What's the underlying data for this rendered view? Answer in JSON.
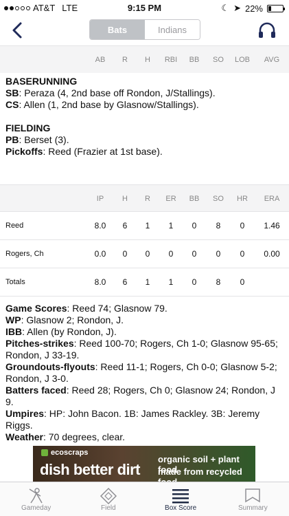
{
  "status": {
    "carrier": "AT&T",
    "network": "LTE",
    "time": "9:15 PM",
    "battery": "22%",
    "battery_level": 0.22
  },
  "nav": {
    "tabs": [
      "Bats",
      "Indians"
    ],
    "active_tab": "Bats"
  },
  "batting_header": [
    "AB",
    "R",
    "H",
    "RBI",
    "BB",
    "SO",
    "LOB",
    "AVG"
  ],
  "baserunning": {
    "title": "BASERUNNING",
    "lines": [
      {
        "label": "SB",
        "text": ": Peraza (4, 2nd base off Rondon, J/Stallings)."
      },
      {
        "label": "CS",
        "text": ": Allen (1, 2nd base by Glasnow/Stallings)."
      }
    ]
  },
  "fielding": {
    "title": "FIELDING",
    "lines": [
      {
        "label": "PB",
        "text": ": Berset (3)."
      },
      {
        "label": "Pickoffs",
        "text": ": Reed (Frazier at 1st base)."
      }
    ]
  },
  "pitching_header": [
    "IP",
    "H",
    "R",
    "ER",
    "BB",
    "SO",
    "HR",
    "ERA"
  ],
  "pitching_rows": [
    {
      "name": "Reed",
      "stats": [
        "8.0",
        "6",
        "1",
        "1",
        "0",
        "8",
        "0",
        "1.46"
      ]
    },
    {
      "name": "Rogers, Ch",
      "stats": [
        "0.0",
        "0",
        "0",
        "0",
        "0",
        "0",
        "0",
        "0.00"
      ]
    },
    {
      "name": "Totals",
      "stats": [
        "8.0",
        "6",
        "1",
        "1",
        "0",
        "8",
        "0",
        ""
      ]
    }
  ],
  "summary": [
    {
      "label": "Game Scores",
      "text": ": Reed 74; Glasnow 79."
    },
    {
      "label": "WP",
      "text": ": Glasnow 2; Rondon, J."
    },
    {
      "label": "IBB",
      "text": ": Allen (by Rondon, J)."
    },
    {
      "label": "Pitches-strikes",
      "text": ": Reed 100-70; Rogers, Ch 1-0; Glasnow 95-65; Rondon, J 33-19."
    },
    {
      "label": "Groundouts-flyouts",
      "text": ": Reed 11-1; Rogers, Ch 0-0; Glasnow 5-2; Rondon, J 3-0."
    },
    {
      "label": "Batters faced",
      "text": ": Reed 28; Rogers, Ch 0; Glasnow 24; Rondon, J 9."
    },
    {
      "label": "Umpires",
      "text": ": HP: John Bacon. 1B: James Rackley. 3B: Jeremy Riggs."
    },
    {
      "label": "Weather",
      "text": ": 70 degrees, clear."
    }
  ],
  "ad": {
    "brand": "ecoscraps",
    "headline": "dish better dirt",
    "tagline1": "organic soil + plant food",
    "tagline2": "made from recycled food."
  },
  "tabbar": [
    {
      "label": "Gameday",
      "icon": "batter-icon"
    },
    {
      "label": "Field",
      "icon": "diamond-icon"
    },
    {
      "label": "Box Score",
      "icon": "box-score-icon",
      "active": true
    },
    {
      "label": "Summary",
      "icon": "summary-icon"
    }
  ]
}
